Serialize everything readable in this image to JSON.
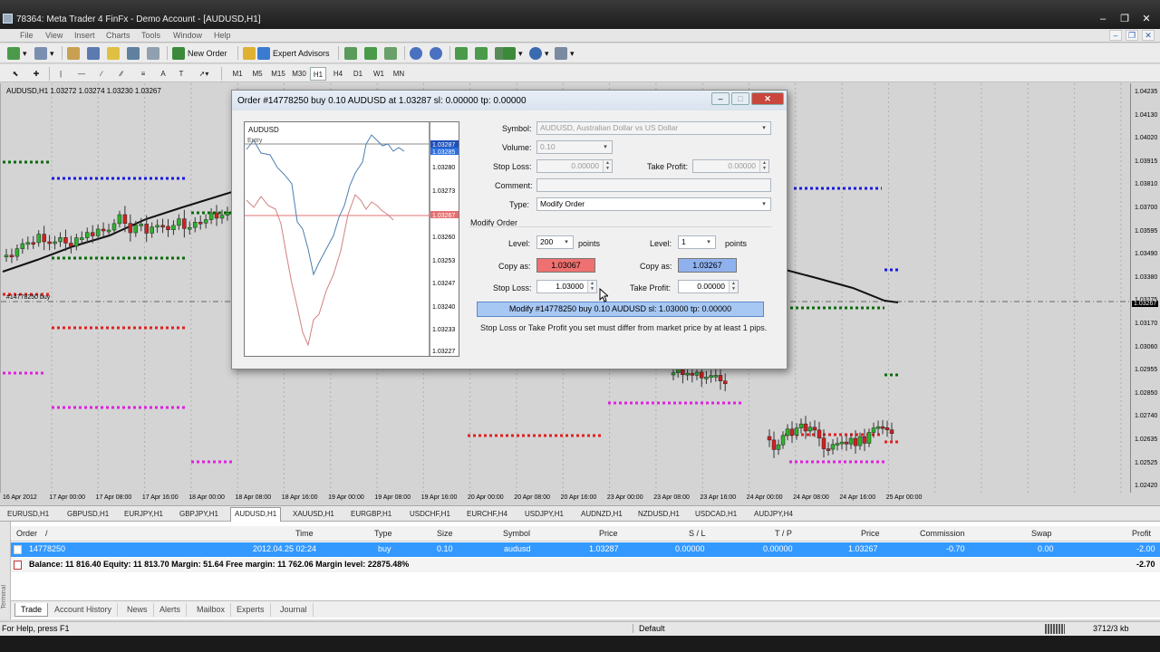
{
  "window": {
    "title": "78364: Meta Trader 4 FinFx - Demo Account - [AUDUSD,H1]"
  },
  "menu": [
    "File",
    "View",
    "Insert",
    "Charts",
    "Tools",
    "Window",
    "Help"
  ],
  "toolbar": {
    "new_order": "New Order",
    "expert_advisors": "Expert Advisors"
  },
  "timeframes": [
    "M1",
    "M5",
    "M15",
    "M30",
    "H1",
    "H4",
    "D1",
    "W1",
    "MN"
  ],
  "timeframe_selected": "H1",
  "chart": {
    "caption": "AUDUSD,H1  1.03272 1.03274 1.03230 1.03267",
    "order_line_label": "#14778250 buy",
    "price_labels": [
      "1.04235",
      "1.04130",
      "1.04020",
      "1.03915",
      "1.03810",
      "1.03700",
      "1.03595",
      "1.03490",
      "1.03380",
      "1.03275",
      "1.03267",
      "1.03170",
      "1.03060",
      "1.02955",
      "1.02850",
      "1.02740",
      "1.02635",
      "1.02525",
      "1.02420"
    ],
    "current_price": "1.03267",
    "time_labels": [
      "16 Apr 2012",
      "17 Apr 00:00",
      "17 Apr 08:00",
      "17 Apr 16:00",
      "18 Apr 00:00",
      "18 Apr 08:00",
      "18 Apr 16:00",
      "19 Apr 00:00",
      "19 Apr 08:00",
      "19 Apr 16:00",
      "20 Apr 00:00",
      "20 Apr 08:00",
      "20 Apr 16:00",
      "23 Apr 00:00",
      "23 Apr 08:00",
      "23 Apr 16:00",
      "24 Apr 00:00",
      "24 Apr 08:00",
      "24 Apr 16:00",
      "25 Apr 00:00"
    ],
    "colors": {
      "bull": "#2db32d",
      "bear": "#d42020",
      "ma": "#111111",
      "blue_dots": "#1a1ae0",
      "green_dots": "#0a6a0a",
      "red_dots": "#e02020",
      "magenta_dots": "#e020e0"
    }
  },
  "symbol_tabs": [
    "EURUSD,H1",
    "GBPUSD,H1",
    "EURJPY,H1",
    "GBPJPY,H1",
    "AUDUSD,H1",
    "XAUUSD,H1",
    "EURGBP,H1",
    "USDCHF,H1",
    "EURCHF,H4",
    "USDJPY,H1",
    "AUDNZD,H1",
    "NZDUSD,H1",
    "USDCAD,H1",
    "AUDJPY,H4"
  ],
  "symbol_tab_active": "AUDUSD,H1",
  "terminal": {
    "side_label": "Terminal",
    "columns": [
      "Order",
      "/",
      "Time",
      "Type",
      "Size",
      "Symbol",
      "Price",
      "S / L",
      "T / P",
      "Price",
      "Commission",
      "Swap",
      "Profit"
    ],
    "row": {
      "order": "14778250",
      "time": "2012.04.25 02:24",
      "type": "buy",
      "size": "0.10",
      "symbol": "audusd",
      "price": "1.03287",
      "sl": "0.00000",
      "tp": "0.00000",
      "price2": "1.03267",
      "commission": "-0.70",
      "swap": "0.00",
      "profit": "-2.00"
    },
    "balance_text": "Balance: 11 816.40  Equity: 11 813.70  Margin: 51.64  Free margin: 11 762.06  Margin level: 22875.48%",
    "balance_profit": "-2.70",
    "tabs": [
      "Trade",
      "Account History",
      "News",
      "Alerts",
      "Mailbox",
      "Experts",
      "Journal"
    ],
    "tab_active": "Trade"
  },
  "status": {
    "help": "For Help, press F1",
    "profile": "Default",
    "traffic": "3712/3 kb"
  },
  "dialog": {
    "title": "Order #14778250 buy 0.10 AUDUSD at 1.03287 sl: 0.00000 tp: 0.00000",
    "mini_chart": {
      "symbol": "AUDUSD",
      "entry_label": "Entry",
      "price_labels": [
        "1.03287",
        "1.03285",
        "1.03280",
        "1.03273",
        "1.03267",
        "1.03260",
        "1.03253",
        "1.03247",
        "1.03240",
        "1.03233",
        "1.03227"
      ],
      "bid_tag": "1.03287",
      "ask_tag": "1.03285",
      "red_tag": "1.03267"
    },
    "symbol_label": "Symbol:",
    "symbol_value": "AUDUSD, Australian Dollar vs US Dollar",
    "volume_label": "Volume:",
    "volume_value": "0.10",
    "stop_loss_label": "Stop Loss:",
    "stop_loss_value": "0.00000",
    "take_profit_label": "Take Profit:",
    "take_profit_value": "0.00000",
    "comment_label": "Comment:",
    "comment_value": "",
    "type_label": "Type:",
    "type_value": "Modify Order",
    "section_label": "Modify Order",
    "level_label": "Level:",
    "level_left_value": "200",
    "level_right_value": "1",
    "points_label": "points",
    "copy_as_label": "Copy as:",
    "copy_left_value": "1.03067",
    "copy_right_value": "1.03267",
    "modify_sl_value": "1.03000",
    "modify_tp_value": "0.00000",
    "modify_button": "Modify #14778250 buy 0.10 AUDUSD sl: 1.03000 tp: 0.00000",
    "hint": "Stop Loss or Take Profit you set must differ from market price by at least 1 pips."
  }
}
